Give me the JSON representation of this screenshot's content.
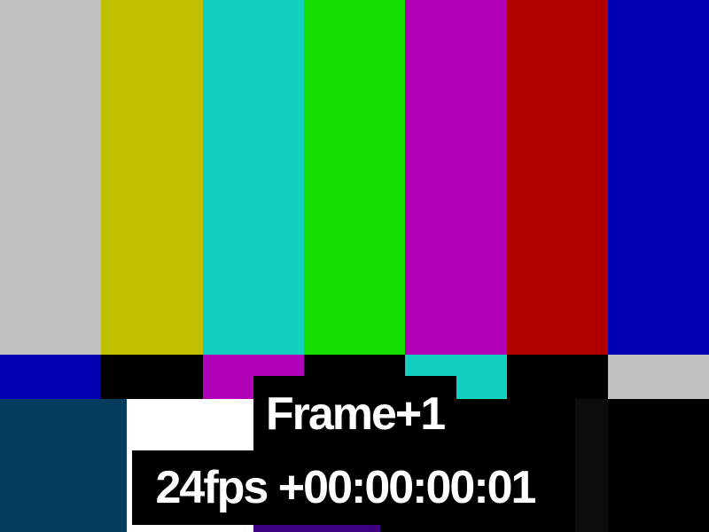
{
  "test_pattern": {
    "top_bars": [
      "#c0c0c0",
      "#c0c000",
      "#12cfc0",
      "#12df00",
      "#b000b8",
      "#b00000",
      "#0000b0"
    ],
    "middle_bars": [
      "#0000b0",
      "#000000",
      "#b000b8",
      "#000000",
      "#12cfc0",
      "#000000",
      "#c0c0c0"
    ],
    "bottom_colors": {
      "dark_blue": "#063d5e",
      "white": "#ffffff",
      "purple": "#3a0080",
      "black": "#000000",
      "pluge_dark": "#0c0c0c"
    }
  },
  "overlay": {
    "frame_label": "Frame+1",
    "timecode_label": "24fps +00:00:00:01"
  }
}
